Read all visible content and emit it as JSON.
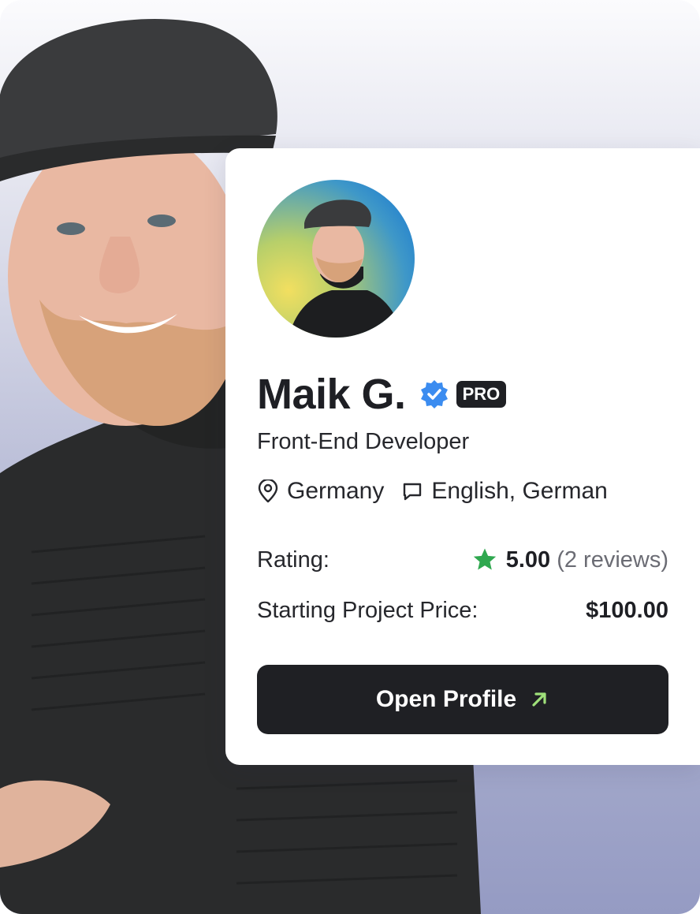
{
  "profile": {
    "name": "Maik G.",
    "badge": "PRO",
    "title": "Front-End Developer",
    "location": "Germany",
    "languages": "English, German",
    "rating_label": "Rating:",
    "rating_score": "5.00",
    "rating_reviews": "(2 reviews)",
    "price_label": "Starting Project Price:",
    "price_value": "$100.00",
    "cta_label": "Open Profile"
  },
  "colors": {
    "verified": "#3b8cf0",
    "star": "#2fa84f",
    "cta_arrow": "#9fe07a",
    "cta_bg": "#1f2024"
  },
  "icons": {
    "verified": "verified-badge-icon",
    "location": "map-pin-icon",
    "language": "chat-bubble-icon",
    "star": "star-icon",
    "arrow": "arrow-up-right-icon"
  }
}
